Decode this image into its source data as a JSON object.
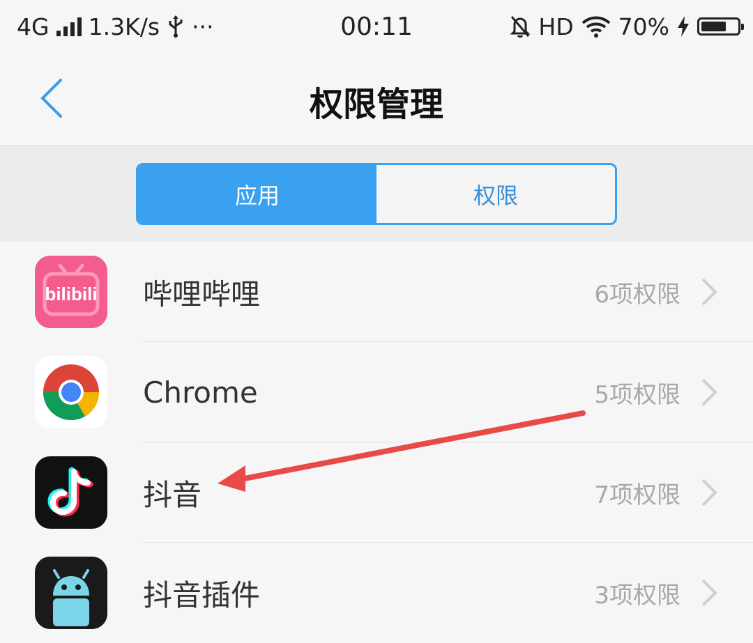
{
  "status_bar": {
    "network": "4G",
    "speed": "1.3K/s",
    "usb_icon": "usb-icon",
    "more": "···",
    "time": "00:11",
    "hd": "HD",
    "battery_percent": "70%",
    "battery_level": 0.7
  },
  "header": {
    "back_icon": "chevron-left-icon",
    "title": "权限管理"
  },
  "segmented": {
    "tab_apps": "应用",
    "tab_permissions": "权限"
  },
  "apps": [
    {
      "name": "哔哩哔哩",
      "permissions": "6项权限",
      "icon": "bilibili-icon"
    },
    {
      "name": "Chrome",
      "permissions": "5项权限",
      "icon": "chrome-icon"
    },
    {
      "name": "抖音",
      "permissions": "7项权限",
      "icon": "douyin-icon"
    },
    {
      "name": "抖音插件",
      "permissions": "3项权限",
      "icon": "android-icon"
    }
  ],
  "colors": {
    "accent": "#3aa0f0",
    "annotation_arrow": "#e84a4a"
  }
}
